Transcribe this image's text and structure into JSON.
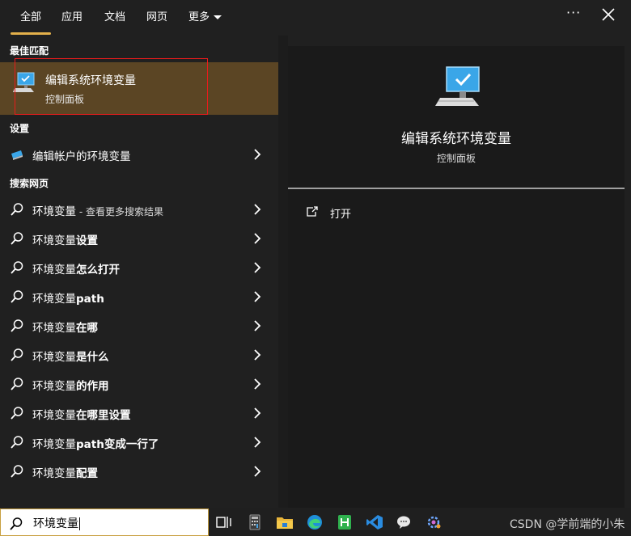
{
  "tabs": [
    {
      "label": "全部"
    },
    {
      "label": "应用"
    },
    {
      "label": "文档"
    },
    {
      "label": "网页"
    },
    {
      "label": "更多"
    }
  ],
  "toolbar": {
    "ellipsis": "···"
  },
  "sections": {
    "best_match": "最佳匹配",
    "settings": "设置",
    "web": "搜索网页"
  },
  "best_match": {
    "title": "编辑系统环境变量",
    "subtitle": "控制面板",
    "icon": "monitor-check-icon"
  },
  "settings_item": {
    "label": "编辑帐户的环境变量",
    "icon": "monitor-edit-icon"
  },
  "web_items": [
    {
      "prefix": "环境变量",
      "bold": "",
      "extra": " - 查看更多搜索结果"
    },
    {
      "prefix": "环境变量",
      "bold": "设置",
      "extra": ""
    },
    {
      "prefix": "环境变量",
      "bold": "怎么打开",
      "extra": ""
    },
    {
      "prefix": "环境变量",
      "bold": "path",
      "extra": ""
    },
    {
      "prefix": "环境变量",
      "bold": "在哪",
      "extra": ""
    },
    {
      "prefix": "环境变量",
      "bold": "是什么",
      "extra": ""
    },
    {
      "prefix": "环境变量",
      "bold": "的作用",
      "extra": ""
    },
    {
      "prefix": "环境变量",
      "bold": "在哪里设置",
      "extra": ""
    },
    {
      "prefix": "环境变量",
      "bold": "path变成一行了",
      "extra": ""
    },
    {
      "prefix": "环境变量",
      "bold": "配置",
      "extra": ""
    }
  ],
  "detail": {
    "title": "编辑系统环境变量",
    "subtitle": "控制面板",
    "open_label": "打开"
  },
  "taskbar": {
    "search_value": "环境变量",
    "watermark": "CSDN @学前端的小朱",
    "icons": [
      "task-view-icon",
      "calculator-icon",
      "file-explorer-icon",
      "edge-icon",
      "hbuilder-icon",
      "vscode-icon",
      "wechat-icon",
      "settings-app-icon"
    ]
  },
  "colors": {
    "accent": "#e3b04b",
    "selection": "#5b4524",
    "highlight_box": "#e81b1b"
  }
}
